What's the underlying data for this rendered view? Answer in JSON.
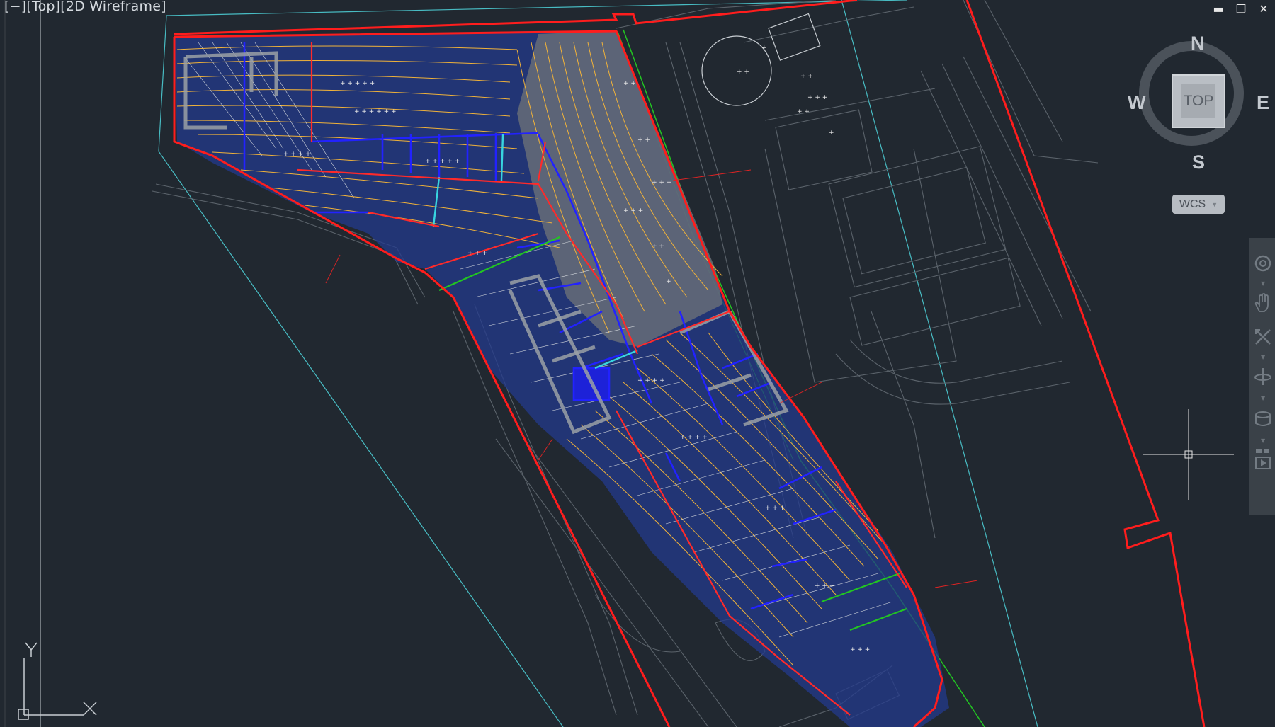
{
  "viewport": {
    "label_open": "[",
    "label_minus": "−",
    "label_close": "]",
    "view": "[Top]",
    "visual_style": "[2D Wireframe]"
  },
  "window_controls": {
    "minimize": "▬",
    "restore": "❐",
    "close": "✕"
  },
  "viewcube": {
    "north": "N",
    "south": "S",
    "east": "E",
    "west": "W",
    "face": "TOP"
  },
  "ucs_menu": {
    "label": "WCS",
    "caret": "▼"
  },
  "ucs_icon": {
    "y_label": "Y",
    "x_label": "X"
  },
  "navigation_bar": {
    "tools": [
      "steering-wheel-icon",
      "pan-icon",
      "zoom-extents-icon",
      "orbit-icon",
      "showmotion-icon"
    ]
  },
  "colors": {
    "background": "#212830",
    "boundary": "#ff1a1a",
    "grading": "#f5b731",
    "drain": "#2020ff",
    "cyan": "#38d4e0",
    "green": "#21c821",
    "neighbor_lines": "#5f666d",
    "survey_marks": "#e6e6e6"
  }
}
